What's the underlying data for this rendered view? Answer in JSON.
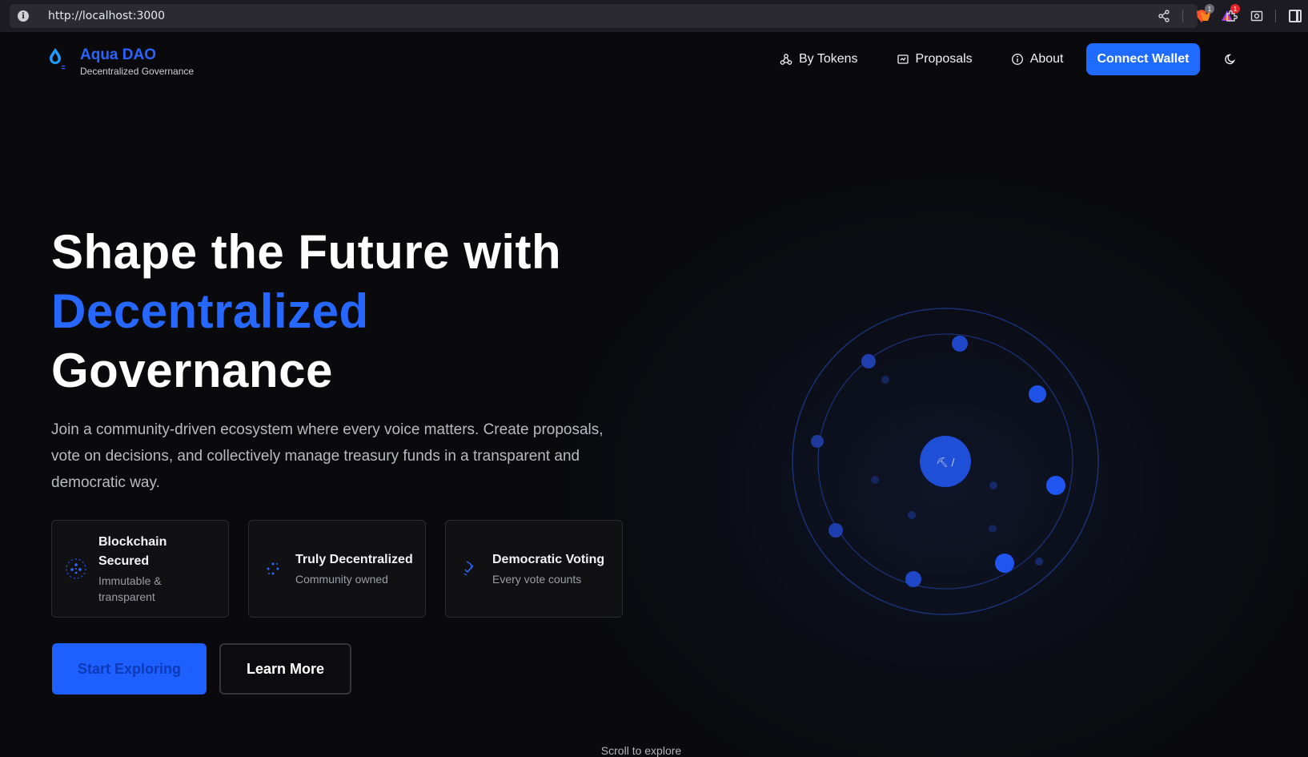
{
  "browser": {
    "url": "http://localhost:3000",
    "icons": [
      "info-icon",
      "share-icon",
      "brave-shield-icon",
      "brave-rewards-icon",
      "metamask-icon",
      "extensions-icon",
      "screenshot-icon",
      "sidebar-icon"
    ],
    "badges": {
      "shield": "1",
      "rewards": "1"
    }
  },
  "nav": {
    "brand_title": "Aqua DAO",
    "brand_sub": "Decentralized Governance",
    "links": [
      {
        "label": "By Tokens",
        "icon": "tokens-icon"
      },
      {
        "label": "Proposals",
        "icon": "proposals-icon"
      },
      {
        "label": "About",
        "icon": "info-circle-icon"
      }
    ],
    "connect_label": "Connect Wallet",
    "theme_icon": "moon-icon"
  },
  "hero": {
    "title_line1": "Shape the Future with",
    "title_accent": "Decentralized",
    "title_line3": "Governance",
    "description": "Join a community-driven ecosystem where every voice matters. Create proposals, vote on decisions, and collectively manage treasury funds in a transparent and democratic way.",
    "features": [
      {
        "title": "Blockchain Secured",
        "sub": "Immutable & transparent",
        "icon": "blockchain-icon"
      },
      {
        "title": "Truly Decentralized",
        "sub": "Community owned",
        "icon": "network-icon"
      },
      {
        "title": "Democratic Voting",
        "sub": "Every vote counts",
        "icon": "vote-icon"
      }
    ],
    "primary_button": "Start Exploring",
    "secondary_button": "Learn More",
    "scroll_hint": "Scroll to explore"
  },
  "orbit": {
    "center_glyph": "⛏ /",
    "accent": "#1f5cff"
  },
  "colors": {
    "accent": "#2668ff",
    "background": "#0a0a0c",
    "button": "#1f6bff"
  }
}
